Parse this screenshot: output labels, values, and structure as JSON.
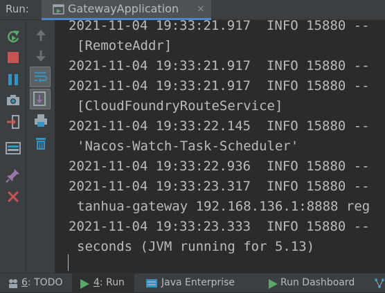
{
  "header": {
    "run_label": "Run:",
    "tab_title": "GatewayApplication",
    "tab_close": "×"
  },
  "console": {
    "lines": [
      "2021-11-04 19:33:21.917  INFO 15880 --",
      "[RemoteAddr]",
      "2021-11-04 19:33:21.917  INFO 15880 --",
      "2021-11-04 19:33:21.917  INFO 15880 --",
      "[CloudFoundryRouteService]",
      "2021-11-04 19:33:22.145  INFO 15880 --",
      "'Nacos-Watch-Task-Scheduler'",
      "2021-11-04 19:33:22.936  INFO 15880 --",
      "2021-11-04 19:33:23.317  INFO 15880 --",
      "tanhua-gateway 192.168.136.1:8888 reg",
      "2021-11-04 19:33:23.333  INFO 15880 --",
      "seconds (JVM running for 5.13)"
    ]
  },
  "bottom": {
    "todo_num": "6",
    "todo_text": ": TODO",
    "run_num": "4",
    "run_text": ": Run",
    "java_enterprise": "Java Enterprise",
    "run_dashboard": "Run Dashboard"
  },
  "colors": {
    "accent": "#4a88c7",
    "background": "#2b2b2b",
    "toolbar": "#3c3f41",
    "text": "#bbbbbb"
  }
}
